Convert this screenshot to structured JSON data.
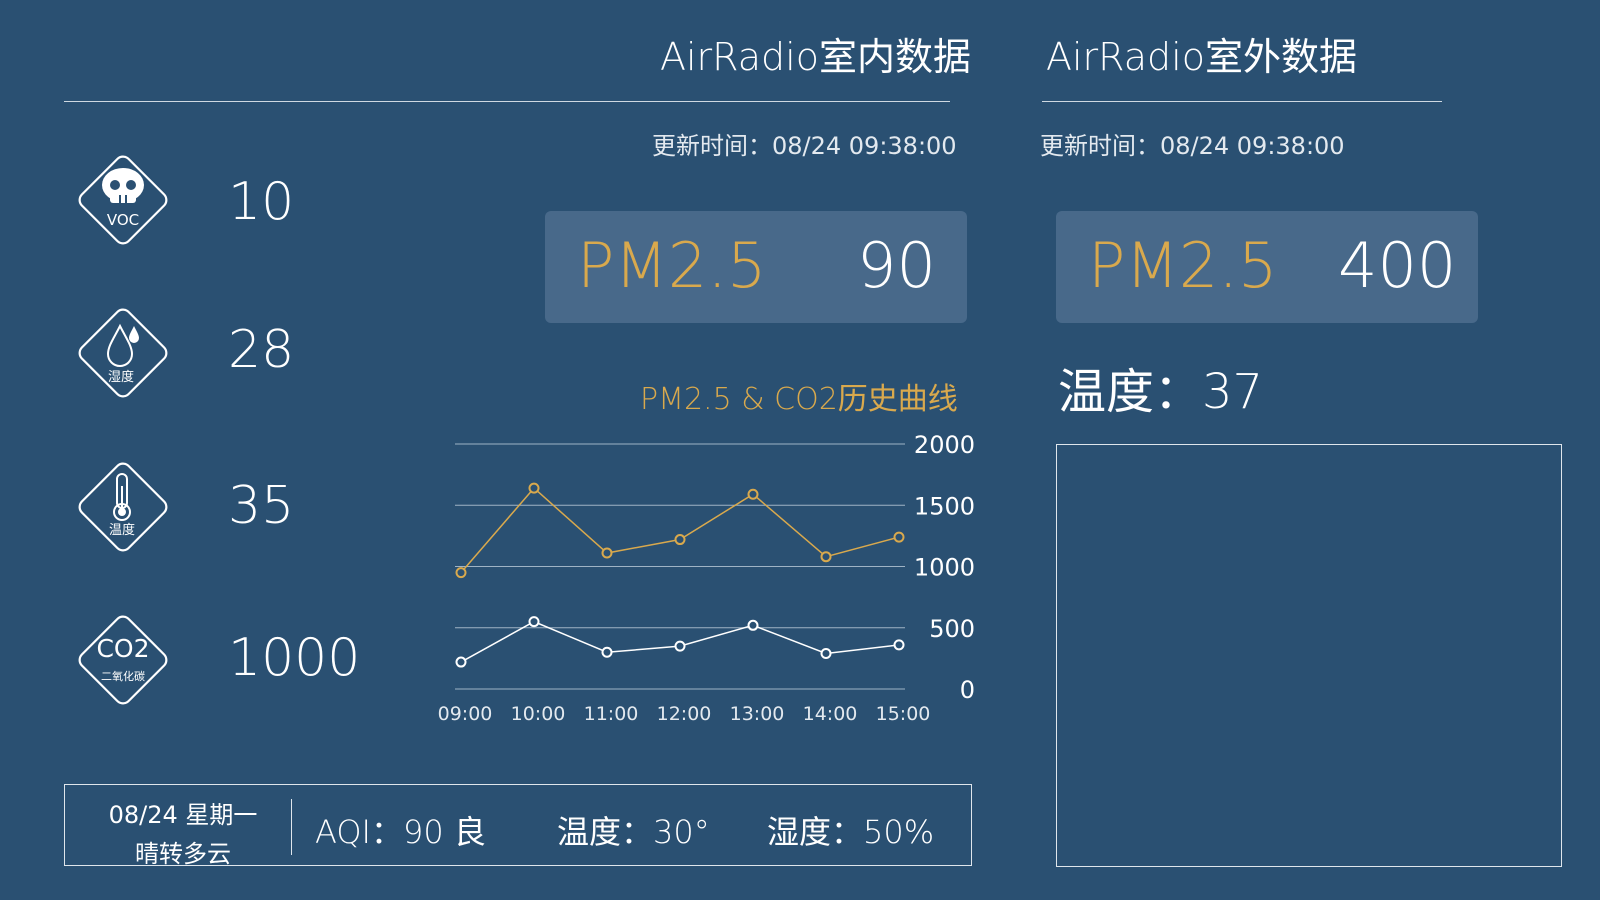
{
  "indoor": {
    "title": "AirRadio室内数据",
    "update_time": "更新时间：08/24  09:38:00",
    "pm25_label": "PM2.5",
    "pm25_value": "90"
  },
  "outdoor": {
    "title": "AirRadio室外数据",
    "update_time": "更新时间：08/24  09:38:00",
    "pm25_label": "PM2.5",
    "pm25_value": "400",
    "temperature": "温度：37"
  },
  "sensors": [
    {
      "icon": "skull-voc-icon",
      "label": "VOC",
      "value": "10"
    },
    {
      "icon": "droplet-humidity-icon",
      "label": "湿度",
      "value": "28"
    },
    {
      "icon": "thermometer-temperature-icon",
      "label": "温度",
      "value": "35"
    },
    {
      "icon": "co2-icon",
      "label": "CO2",
      "sublabel": "二氧化碳",
      "value": "1000"
    }
  ],
  "weather": {
    "date": "08/24   星期一",
    "condition": "晴转多云",
    "aqi": "AQI：90  良",
    "temperature": "温度：30°",
    "humidity": "湿度：50%"
  },
  "colors": {
    "background": "#2a5072",
    "accent_gold": "#d9a94d",
    "box": "#48698a",
    "line_white": "#ffffff"
  },
  "chart_data": {
    "type": "line",
    "title": "PM2.5 & CO2历史曲线",
    "x": [
      "09:00",
      "10:00",
      "11:00",
      "12:00",
      "13:00",
      "14:00",
      "15:00"
    ],
    "y_ticks": [
      "0",
      "500",
      "1000",
      "1500",
      "2000"
    ],
    "ylim": [
      0,
      2000
    ],
    "grid": true,
    "series": [
      {
        "color": "#d9a94d",
        "values": [
          950,
          1640,
          1110,
          1220,
          1590,
          1080,
          1240
        ]
      },
      {
        "color": "#ffffff",
        "values": [
          220,
          550,
          300,
          350,
          520,
          290,
          360
        ]
      }
    ]
  }
}
